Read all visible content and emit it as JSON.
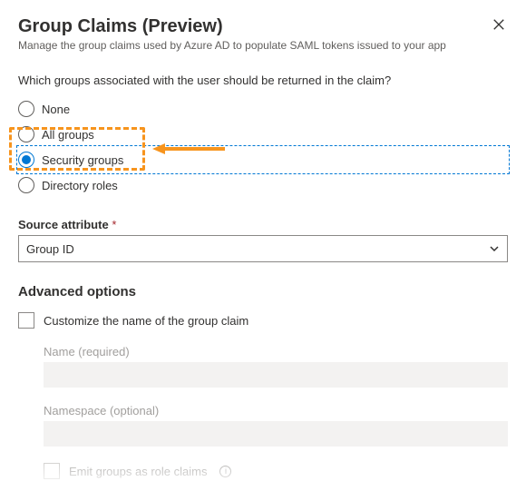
{
  "header": {
    "title": "Group Claims (Preview)",
    "subtitle": "Manage the group claims used by Azure AD to populate SAML tokens issued to your app"
  },
  "question": "Which groups associated with the user should be returned in the claim?",
  "radios": {
    "none": "None",
    "all": "All groups",
    "security": "Security groups",
    "directory": "Directory roles"
  },
  "source_attribute": {
    "label": "Source attribute",
    "required_mark": "*",
    "value": "Group ID"
  },
  "advanced": {
    "heading": "Advanced options",
    "customize_label": "Customize the name of the group claim",
    "name_label": "Name (required)",
    "name_value": "",
    "namespace_label": "Namespace (optional)",
    "namespace_value": "",
    "emit_label": "Emit groups as role claims"
  },
  "highlight_color": "#f7941d"
}
